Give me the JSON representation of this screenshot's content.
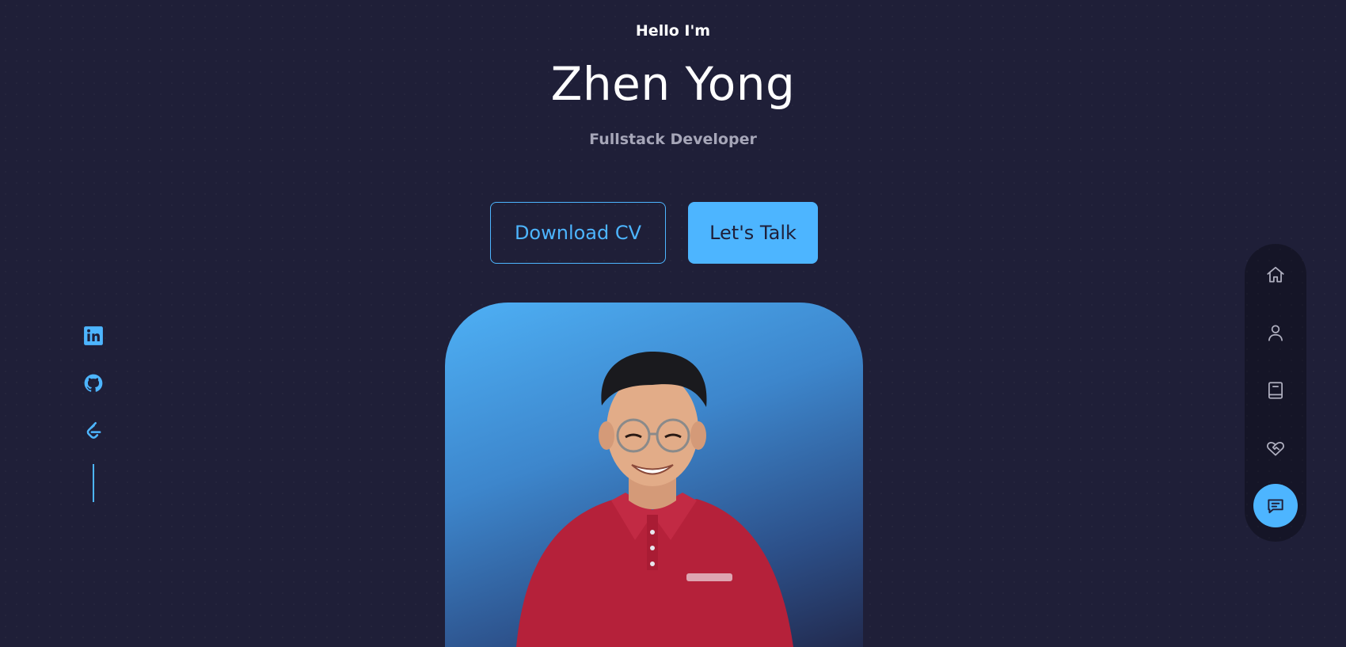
{
  "hero": {
    "greeting": "Hello I'm",
    "name": "Zhen Yong",
    "role": "Fullstack Developer"
  },
  "cta": {
    "download_label": "Download CV",
    "talk_label": "Let's Talk"
  },
  "photo": {
    "alt": "Zhen Yong portrait"
  },
  "socials": [
    {
      "name": "linkedin-icon"
    },
    {
      "name": "github-icon"
    },
    {
      "name": "leetcode-icon"
    }
  ],
  "nav": {
    "items": [
      {
        "name": "home-icon",
        "active": false
      },
      {
        "name": "user-icon",
        "active": false
      },
      {
        "name": "book-icon",
        "active": false
      },
      {
        "name": "heart-handshake-icon",
        "active": false
      },
      {
        "name": "message-icon",
        "active": true
      }
    ]
  },
  "colors": {
    "background": "#1f1f38",
    "accent": "#4db5ff",
    "muted_text": "#a6a6b8",
    "nav_icon": "#b0b0c0"
  }
}
